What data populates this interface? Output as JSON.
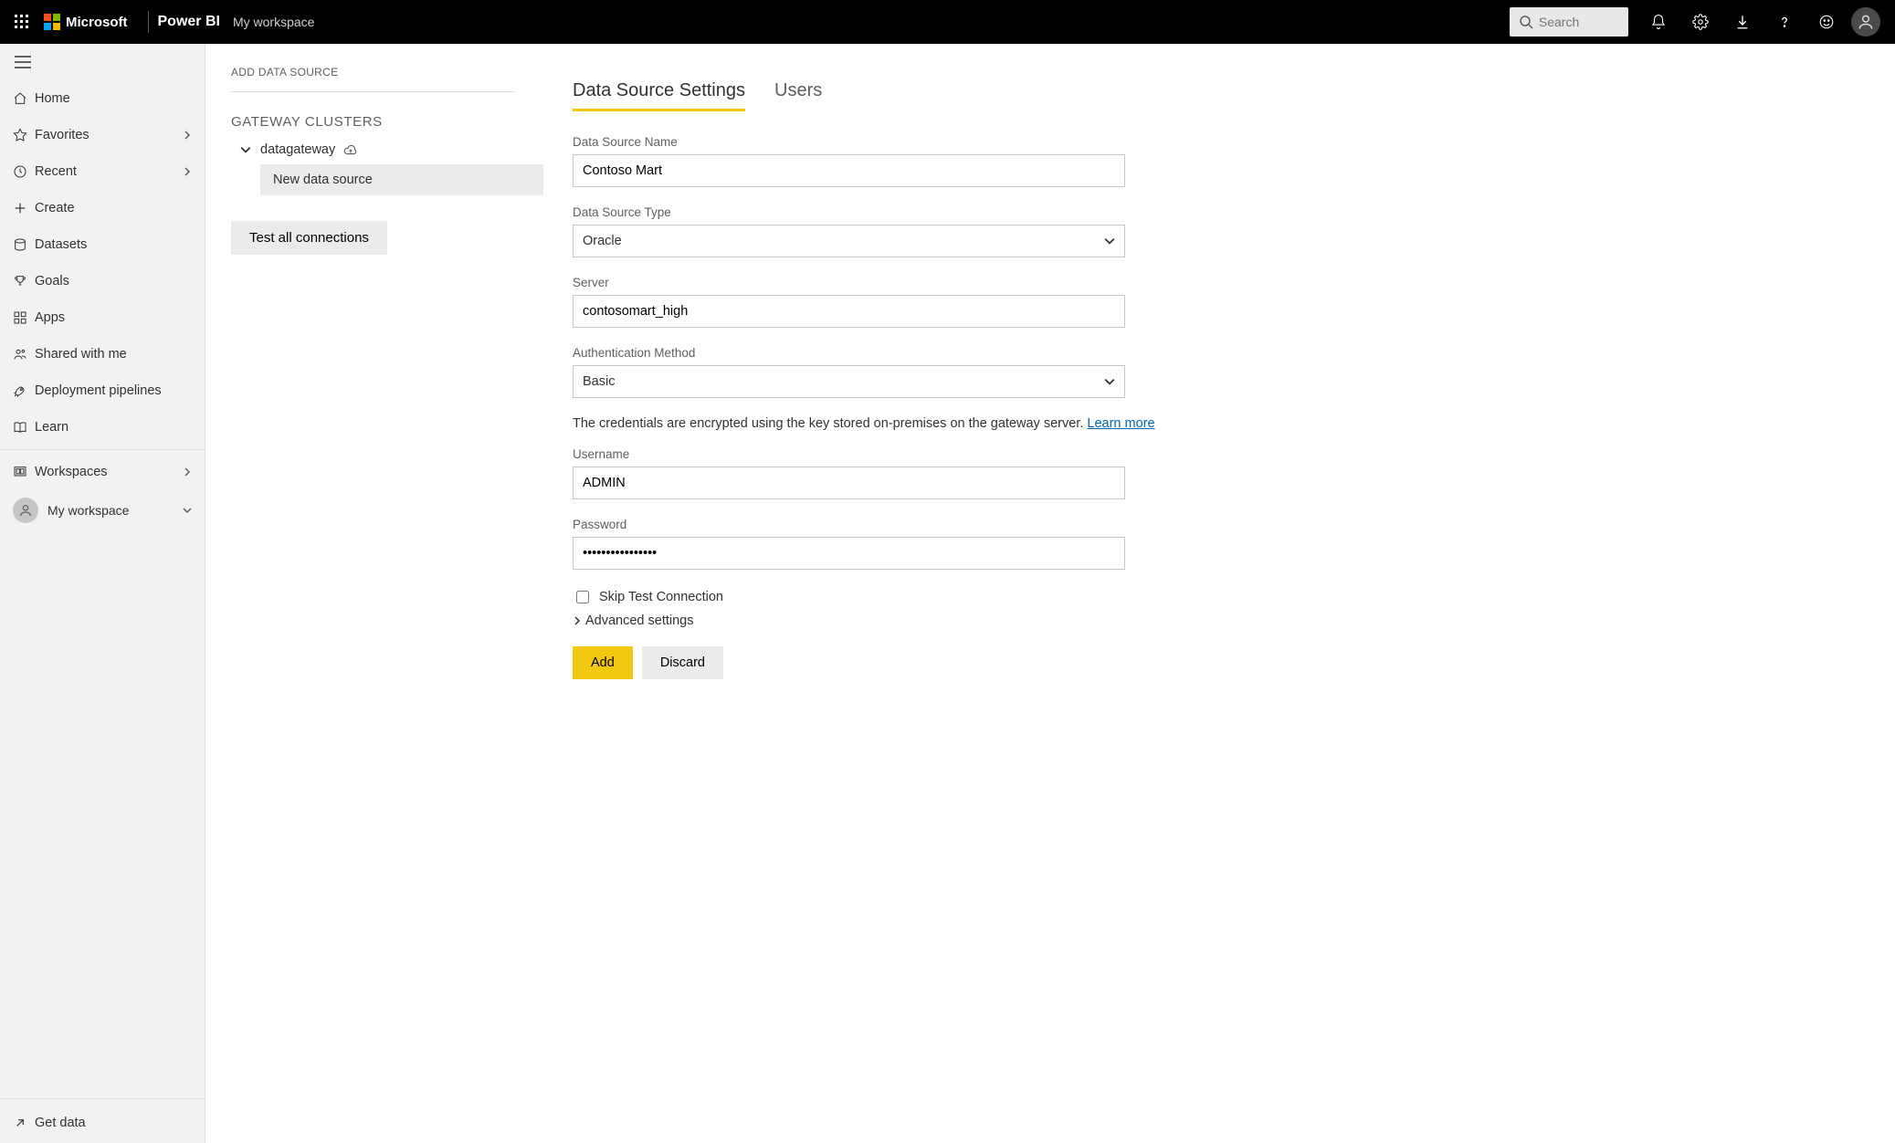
{
  "header": {
    "brand": "Microsoft",
    "product": "Power BI",
    "workspace": "My workspace",
    "search_placeholder": "Search"
  },
  "nav": {
    "items": [
      {
        "label": "Home"
      },
      {
        "label": "Favorites"
      },
      {
        "label": "Recent"
      },
      {
        "label": "Create"
      },
      {
        "label": "Datasets"
      },
      {
        "label": "Goals"
      },
      {
        "label": "Apps"
      },
      {
        "label": "Shared with me"
      },
      {
        "label": "Deployment pipelines"
      },
      {
        "label": "Learn"
      }
    ],
    "workspaces_label": "Workspaces",
    "current_workspace": "My workspace",
    "get_data": "Get data"
  },
  "middle": {
    "breadcrumb": "ADD DATA SOURCE",
    "section_title": "GATEWAY CLUSTERS",
    "gateway_name": "datagateway",
    "new_source": "New data source",
    "test_all": "Test all connections"
  },
  "tabs": {
    "settings": "Data Source Settings",
    "users": "Users"
  },
  "form": {
    "ds_name_label": "Data Source Name",
    "ds_name_value": "Contoso Mart",
    "ds_type_label": "Data Source Type",
    "ds_type_value": "Oracle",
    "server_label": "Server",
    "server_value": "contosomart_high",
    "auth_label": "Authentication Method",
    "auth_value": "Basic",
    "info_text": "The credentials are encrypted using the key stored on-premises on the gateway server. ",
    "learn_more": "Learn more",
    "username_label": "Username",
    "username_value": "ADMIN",
    "password_label": "Password",
    "password_value": "••••••••••••••••",
    "skip_test": "Skip Test Connection",
    "advanced": "Advanced settings",
    "add": "Add",
    "discard": "Discard"
  }
}
